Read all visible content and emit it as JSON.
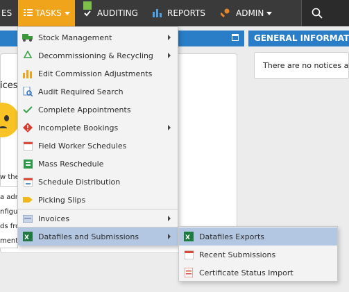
{
  "nav": {
    "partial_left": "ES",
    "tasks": "TASKS",
    "auditing": "AUDITING",
    "reports": "REPORTS",
    "admin": "ADMIN"
  },
  "background": {
    "right_header": "GENERAL INFORMAT",
    "notice_text": "There are no notices at t",
    "left_fragment_1": "ices",
    "left_fragment_2": "w the",
    "left_row_1": "a adm",
    "left_row_2": "nfigu",
    "left_row_3": "ds fro",
    "left_row_4": "ment"
  },
  "menu": {
    "items": [
      {
        "label": "Stock Management",
        "icon": "truck-icon",
        "submenu": true
      },
      {
        "label": "Decommissioning & Recycling",
        "icon": "recycle-icon",
        "submenu": true
      },
      {
        "label": "Edit Commission Adjustments",
        "icon": "bar-chart-icon",
        "submenu": false
      },
      {
        "label": "Audit Required Search",
        "icon": "search-document-icon",
        "submenu": false
      },
      {
        "label": "Complete Appointments",
        "icon": "check-icon",
        "submenu": false
      },
      {
        "label": "Incomplete Bookings",
        "icon": "warning-icon",
        "submenu": true
      },
      {
        "label": "Field Worker Schedules",
        "icon": "calendar-icon",
        "submenu": false
      },
      {
        "label": "Mass Reschedule",
        "icon": "grid-icon",
        "submenu": false
      },
      {
        "label": "Schedule Distribution",
        "icon": "calendar-share-icon",
        "submenu": false
      },
      {
        "label": "Picking Slips",
        "icon": "tag-icon",
        "submenu": false
      },
      {
        "label": "Invoices",
        "icon": "invoice-icon",
        "submenu": true
      },
      {
        "label": "Datafiles and Submissions",
        "icon": "excel-icon",
        "submenu": true
      }
    ]
  },
  "submenu": {
    "items": [
      {
        "label": "Datafiles Exports",
        "icon": "excel-icon"
      },
      {
        "label": "Recent Submissions",
        "icon": "calendar-icon"
      },
      {
        "label": "Certificate Status Import",
        "icon": "document-icon"
      }
    ]
  },
  "colors": {
    "navbar": "#3a3a3a",
    "tasks_active": "#f0a41c",
    "panel_header": "#2a7ec7",
    "menu_highlight": "#b3c7e2"
  }
}
